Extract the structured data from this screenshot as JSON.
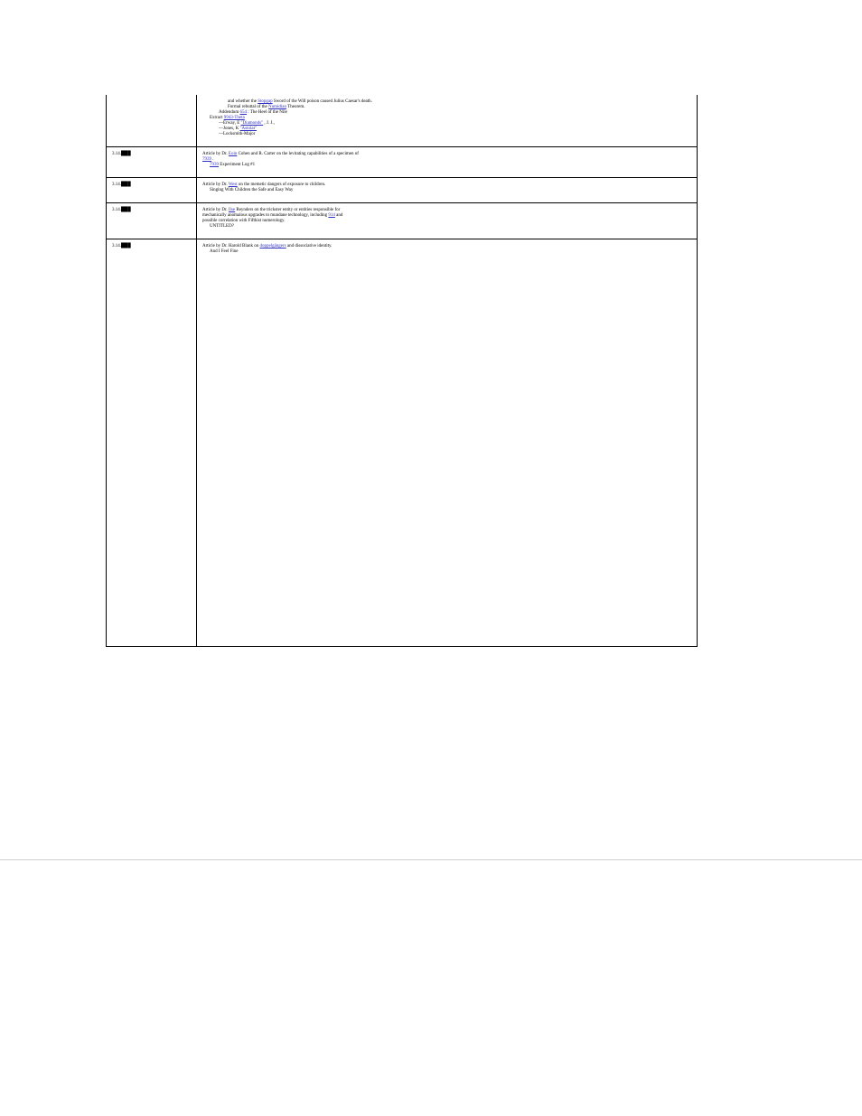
{
  "row0": {
    "col0": "",
    "col1": {
      "l1a": "and whether the ",
      "l1link": "Stopgap",
      "l1b": " Sword of the Will poison caused Julius Caesar's death.",
      "l2a": "Formal rebuttal of the ",
      "l2link": "Numidian",
      "l2b": " Theorem.",
      "l3a": "Addendum ",
      "l3link": "654",
      "l3b": ": The Heel of the Nile",
      "l4a": "Extract ",
      "l4link": "9943-Theta",
      "l4b": "",
      "l5a": "—Erway, E ",
      "l5link": "\"Diamonds\"",
      "l5b": ", J. J.,",
      "l6a": "—Jones, K ",
      "l6link": "\"Astolat\"",
      "l6b": "",
      "l7": "—Locksmith-Major"
    }
  },
  "row1": {
    "col0": "3.14.███",
    "lead": "Article by Dr. ",
    "link": "Eoin",
    "tail": " Cohen and R. Carter on the levitating capabilities of a specimen of",
    "line2link": "7939",
    "line2tail": ".",
    "line3link": "7939",
    "line3tail": " Experiment Log #1"
  },
  "row2": {
    "col0": "3.14.███",
    "lead": "Article by Dr. ",
    "link": "West",
    "tail": " on the memetic dangers of exposure to children.",
    "line2": "Singing With Children the Safe and Easy Way"
  },
  "row3": {
    "col0": "3.14.███",
    "lead": "Article by Dr. ",
    "link": "Ilse",
    "tail": " Reynders on the trickster entity or entities responsible for",
    "line2a": "mechanically anomalous upgrades to mundane technology, including ",
    "line2link": "914",
    "line2tail": " and",
    "line3": "possible correlation with Fifthist numerology.",
    "line4": "UNTITLED?"
  },
  "row4": {
    "col0": "3.14.███",
    "lead": "Article by Dr. Harold Blank on ",
    "link": "doppelgängers",
    "tail": " and dissociative identity.",
    "line2": "And I Feel Fine"
  }
}
